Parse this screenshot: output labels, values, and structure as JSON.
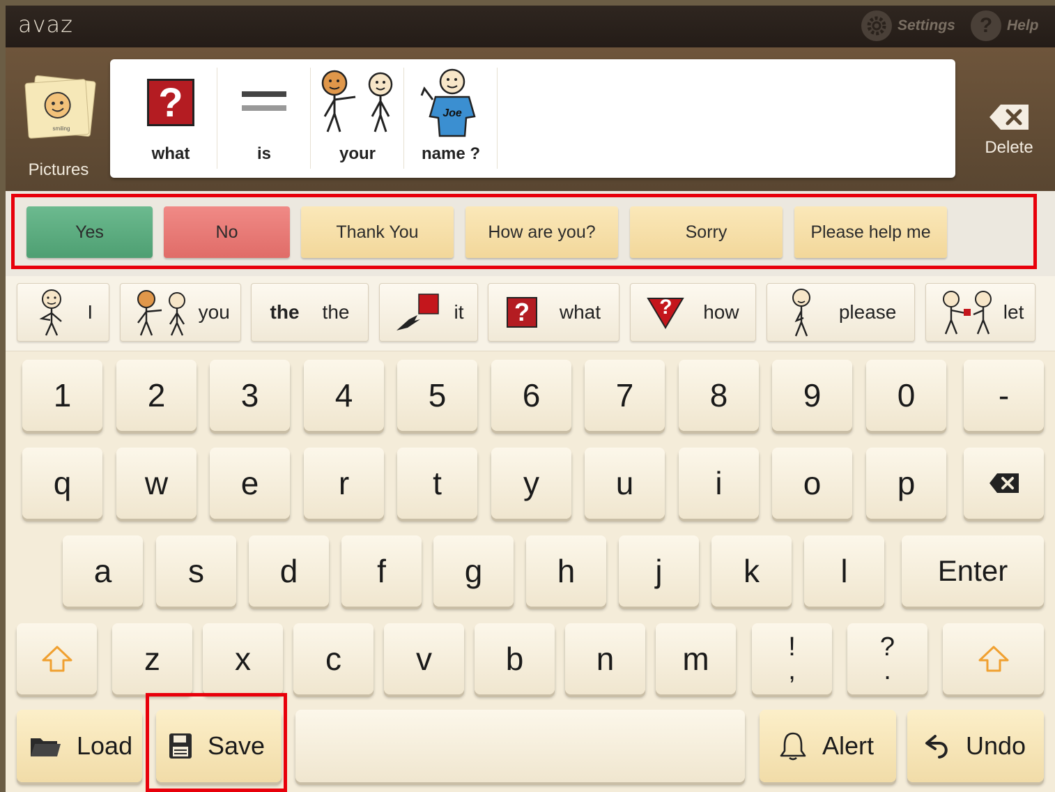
{
  "app": {
    "logo": "avaz"
  },
  "topbar": {
    "settings": {
      "label": "Settings",
      "icon": "gear-icon"
    },
    "help": {
      "label": "Help",
      "icon": "question-icon",
      "glyph": "?"
    }
  },
  "message_area": {
    "pictures_label": "Pictures",
    "card_caption": "smiling",
    "words": [
      {
        "label": "what",
        "symbol": "question-mark-symbol",
        "glyph": "?"
      },
      {
        "label": "is",
        "symbol": "equals-symbol"
      },
      {
        "label": "your",
        "symbol": "your-symbol"
      },
      {
        "label": "name ?",
        "symbol": "name-symbol",
        "badge": "Joe"
      }
    ],
    "delete_label": "Delete"
  },
  "quick_phrases": [
    {
      "label": "Yes",
      "color": "green"
    },
    {
      "label": "No",
      "color": "red"
    },
    {
      "label": "Thank You",
      "color": "cream"
    },
    {
      "label": "How are you?",
      "color": "cream"
    },
    {
      "label": "Sorry",
      "color": "cream"
    },
    {
      "label": "Please help me",
      "color": "cream"
    }
  ],
  "predictions": [
    {
      "label": "I",
      "icon": "person-pointing-self-icon"
    },
    {
      "label": "you",
      "icon": "people-pointing-icon"
    },
    {
      "label": "the",
      "icon_text": "the"
    },
    {
      "label": "it",
      "icon": "hand-pointing-object-icon"
    },
    {
      "label": "what",
      "icon": "question-box-icon",
      "glyph": "?"
    },
    {
      "label": "how",
      "icon": "question-triangle-icon",
      "glyph": "?"
    },
    {
      "label": "please",
      "icon": "person-please-icon"
    },
    {
      "label": "let",
      "icon": "people-giving-icon"
    }
  ],
  "keyboard": {
    "row1": [
      "1",
      "2",
      "3",
      "4",
      "5",
      "6",
      "7",
      "8",
      "9",
      "0",
      "-"
    ],
    "row2": [
      "q",
      "w",
      "e",
      "r",
      "t",
      "y",
      "u",
      "i",
      "o",
      "p"
    ],
    "row3": [
      "a",
      "s",
      "d",
      "f",
      "g",
      "h",
      "j",
      "k",
      "l"
    ],
    "row4": [
      "z",
      "x",
      "c",
      "v",
      "b",
      "n",
      "m"
    ],
    "punct1": {
      "top": "!",
      "bottom": ","
    },
    "punct2": {
      "top": "?",
      "bottom": "."
    },
    "enter": "Enter",
    "load": "Load",
    "save": "Save",
    "alert": "Alert",
    "undo": "Undo"
  },
  "colors": {
    "highlight_outline": "#e8000b",
    "accent_orange": "#f0a030"
  }
}
